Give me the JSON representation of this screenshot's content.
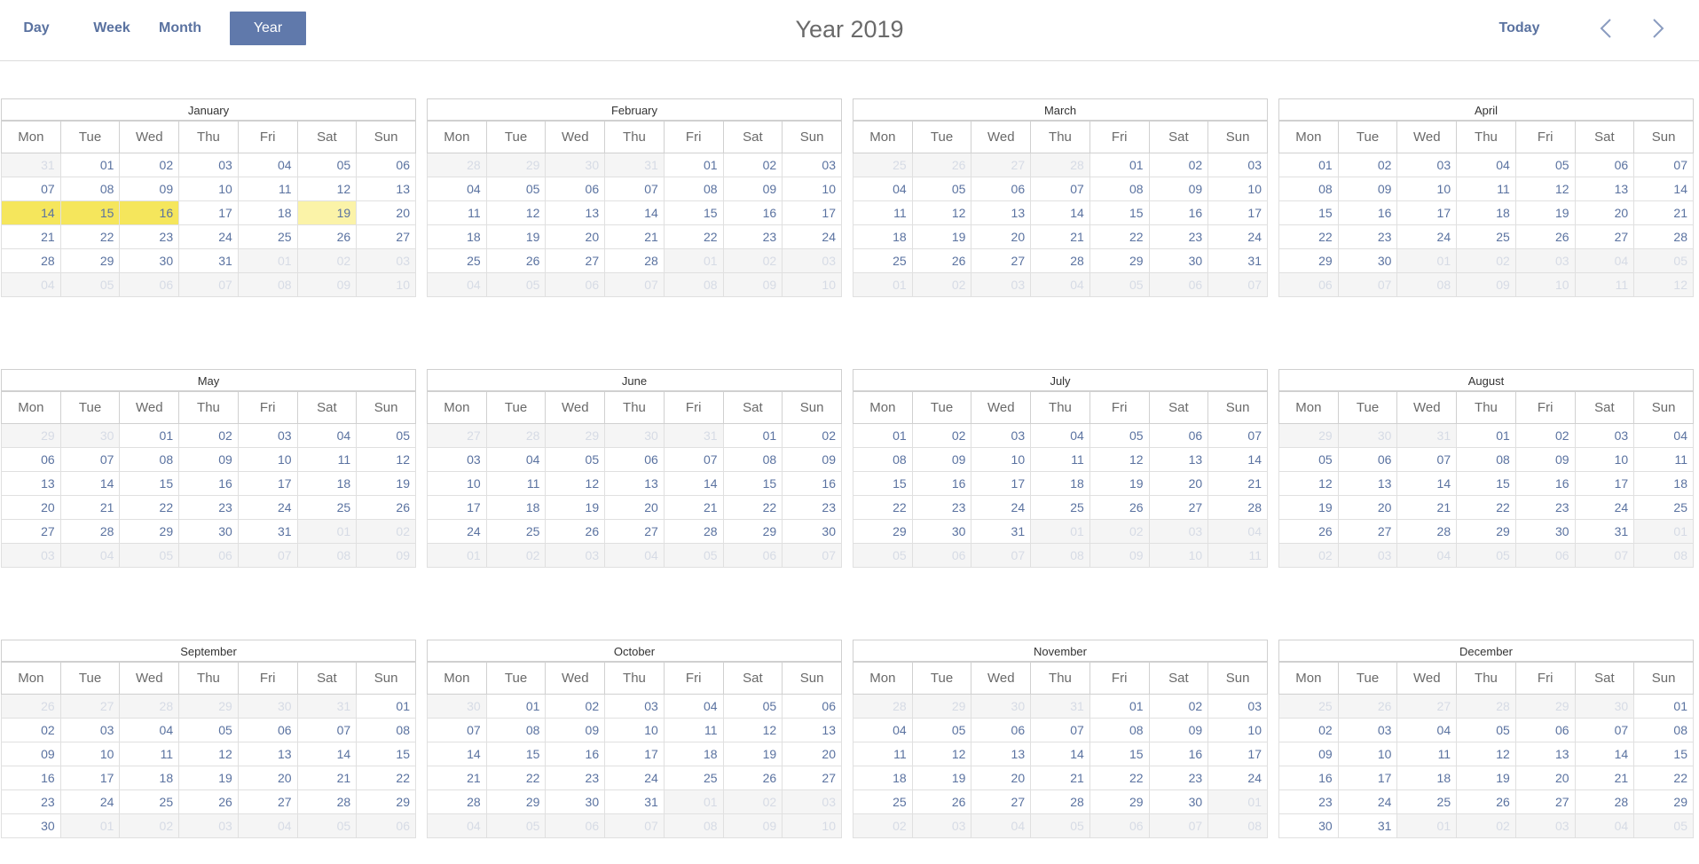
{
  "toolbar": {
    "views": [
      {
        "label": "Day",
        "active": false
      },
      {
        "label": "Week",
        "active": false
      },
      {
        "label": "Month",
        "active": false
      },
      {
        "label": "Year",
        "active": true
      }
    ],
    "title": "Year 2019",
    "today_label": "Today",
    "prev_icon": "chevron-left-icon",
    "next_icon": "chevron-right-icon"
  },
  "year": 2019,
  "weekdays": [
    "Mon",
    "Tue",
    "Wed",
    "Thu",
    "Fri",
    "Sat",
    "Sun"
  ],
  "months": [
    "January",
    "February",
    "March",
    "April",
    "May",
    "June",
    "July",
    "August",
    "September",
    "October",
    "November",
    "December"
  ],
  "highlights": {
    "selected_range": [
      "2019-01-14",
      "2019-01-15",
      "2019-01-16"
    ],
    "today": "2019-01-19"
  },
  "colors": {
    "accent": "#6079ab",
    "link_text": "#5a72a0",
    "selected_fill": "#f5e65c",
    "today_fill": "#fbf3a8",
    "other_month_fill": "#f5f5f5",
    "other_month_text": "#d6dbe5"
  }
}
